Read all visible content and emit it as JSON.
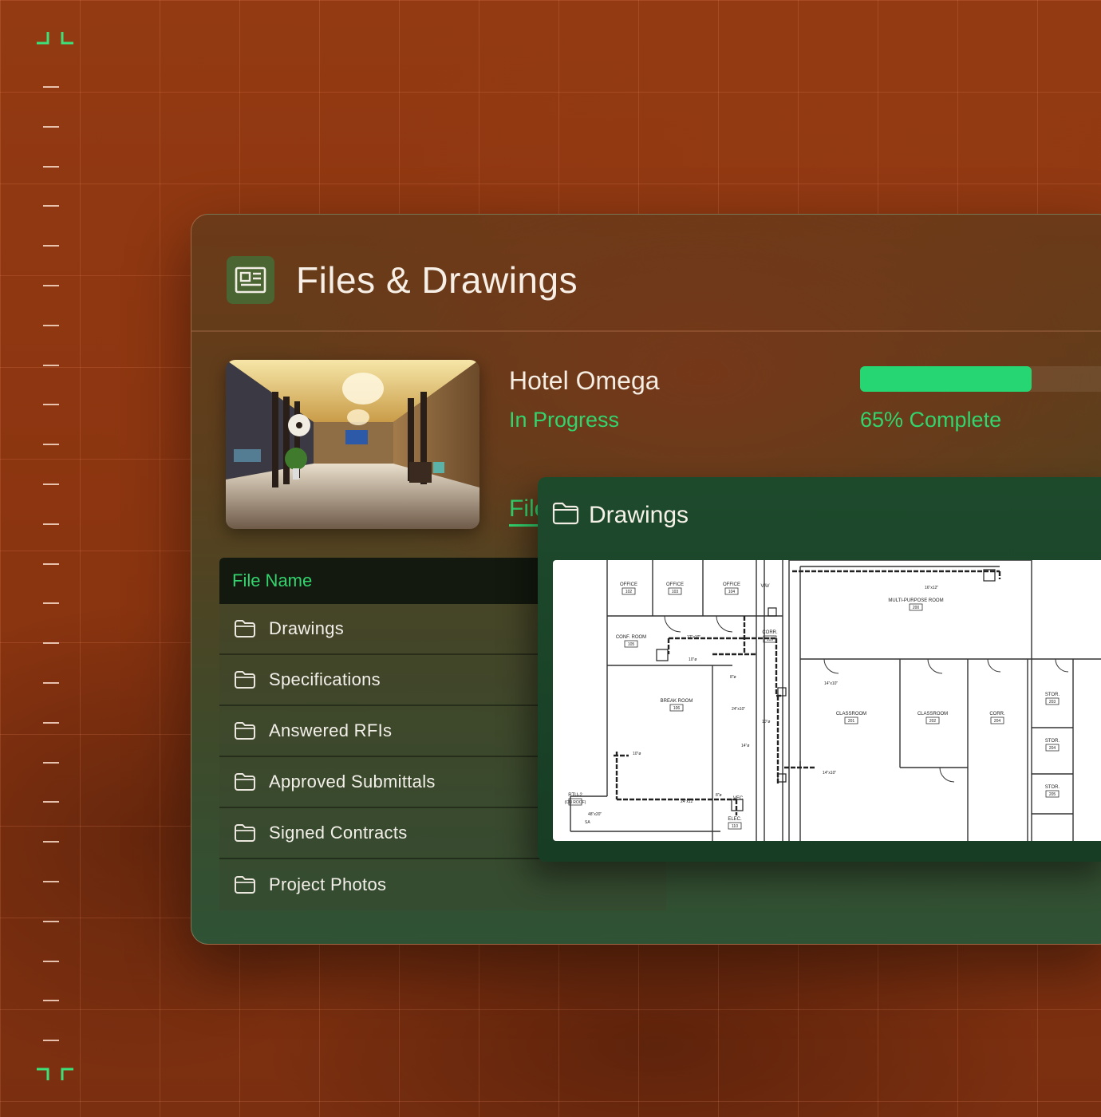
{
  "panel": {
    "title": "Files & Drawings",
    "icon": "document-icon"
  },
  "project": {
    "name": "Hotel Omega",
    "status": "In Progress",
    "progress_percent": 65,
    "progress_label": "65% Complete",
    "tab_label": "Files"
  },
  "table": {
    "header": "File Name",
    "rows": [
      {
        "label": "Drawings"
      },
      {
        "label": "Specifications"
      },
      {
        "label": "Answered RFIs"
      },
      {
        "label": "Approved Submittals"
      },
      {
        "label": "Signed Contracts"
      },
      {
        "label": "Project Photos"
      }
    ]
  },
  "drawings": {
    "title": "Drawings",
    "rooms": [
      {
        "name": "OFFICE",
        "number": "102"
      },
      {
        "name": "OFFICE",
        "number": "103"
      },
      {
        "name": "OFFICE",
        "number": "104"
      },
      {
        "name": "VAV",
        "number": ""
      },
      {
        "name": "CONF. ROOM",
        "number": "105"
      },
      {
        "name": "CORR.",
        "number": "109"
      },
      {
        "name": "MULTI-PURPOSE ROOM",
        "number": "200"
      },
      {
        "name": "BREAK ROOM",
        "number": "106"
      },
      {
        "name": "CLASSROOM",
        "number": "201"
      },
      {
        "name": "CLASSROOM",
        "number": "202"
      },
      {
        "name": "CORR.",
        "number": "204"
      },
      {
        "name": "STOR.",
        "number": "203"
      },
      {
        "name": "STOR.",
        "number": "204"
      },
      {
        "name": "STOR.",
        "number": "205"
      },
      {
        "name": "RTU-2",
        "number": "(ON ROOF)"
      },
      {
        "name": "VEC",
        "number": ""
      },
      {
        "name": "ELEC.",
        "number": "110"
      }
    ],
    "dimensions": [
      "16\"x12\"",
      "12\"x10\"",
      "10\"ø",
      "8\"ø",
      "14\"x10\"",
      "24\"x10\"",
      "10\"ø",
      "14\"ø",
      "24\"x12\"",
      "8\"ø",
      "48\"x20\"",
      "SA",
      "14\"x10\"",
      "10\"ø"
    ]
  },
  "colors": {
    "accent": "#33d46e",
    "progress": "#25d673",
    "icon_bg": "#4a6531"
  }
}
